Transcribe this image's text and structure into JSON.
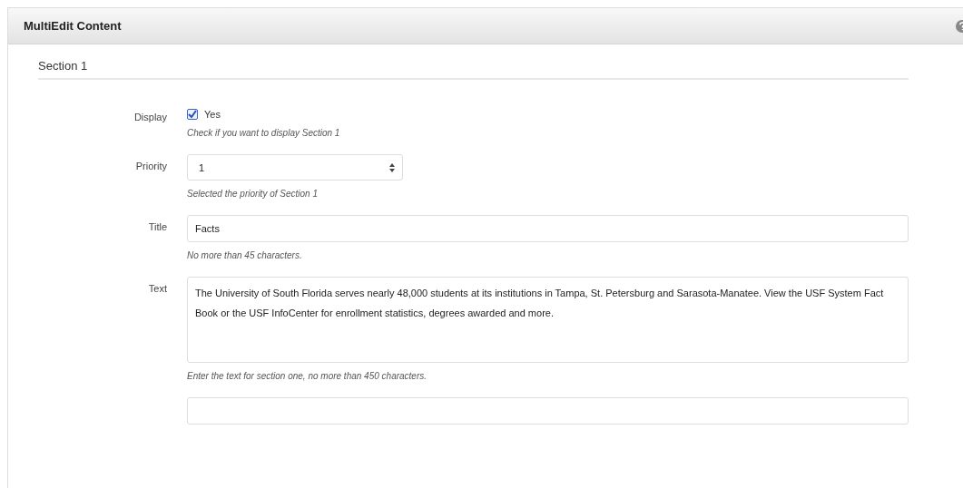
{
  "panel": {
    "title": "MultiEdit Content"
  },
  "section": {
    "title": "Section 1"
  },
  "fields": [
    {
      "kind": "checkbox",
      "label": "Display",
      "option": "Yes",
      "checked": true,
      "hint": "Check if you want to display Section 1"
    },
    {
      "kind": "select",
      "label": "Priority",
      "value": "1",
      "hint": "Selected the priority of Section 1"
    },
    {
      "kind": "text",
      "label": "Title",
      "value": "Facts",
      "hint": "No more than 45 characters."
    },
    {
      "kind": "textarea",
      "label": "Text",
      "value": "The University of South Florida serves nearly 48,000 students at its institutions in Tampa, St. Petersburg and Sarasota-Manatee. View the USF System Fact Book or the USF InfoCenter for enrollment statistics, degrees awarded and more.",
      "hint": "Enter the text for section one, no more than 450 characters."
    },
    {
      "kind": "partial"
    }
  ]
}
